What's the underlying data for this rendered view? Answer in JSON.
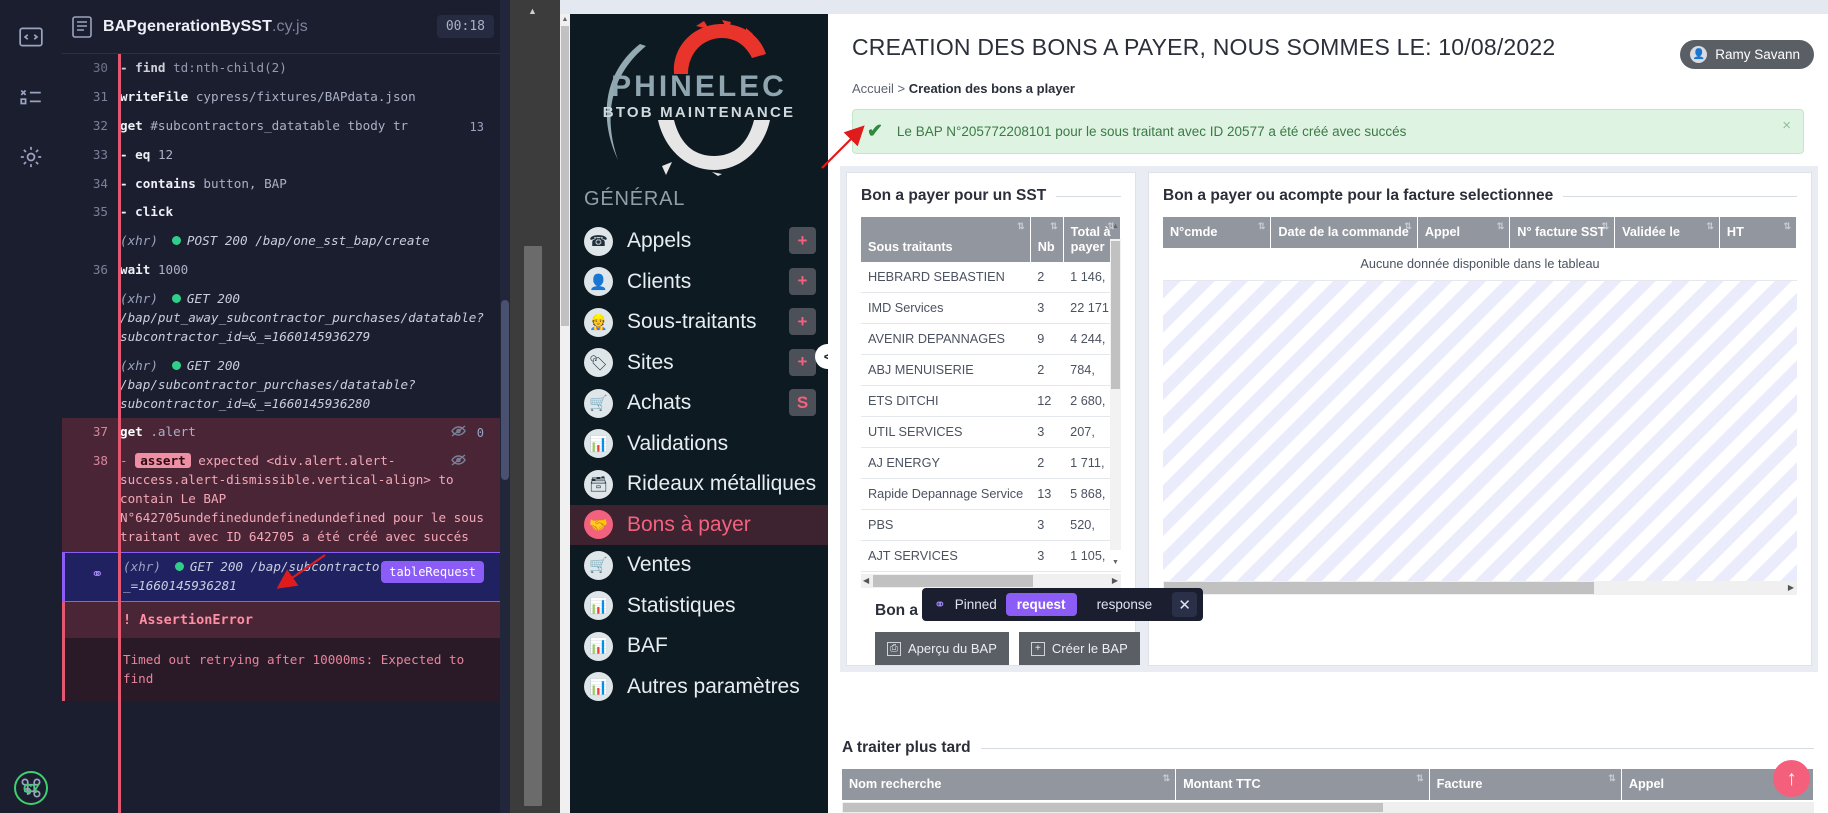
{
  "cypress": {
    "spec_name": "BAPgenerationBySST",
    "spec_ext": ".cy.js",
    "timer": "00:18",
    "iconbar": [
      "code-icon",
      "tests-list-icon",
      "gear-icon"
    ],
    "badge": "CY",
    "rows": [
      {
        "num": "30",
        "cmd": "- find",
        "arg": "td:nth-child(2)",
        "type": "cmd",
        "partial": true
      },
      {
        "num": "31",
        "cmd": "writeFile",
        "arg": "cypress/fixtures/BAPdata.json",
        "type": "cmd"
      },
      {
        "num": "32",
        "cmd": "get",
        "arg": "#subcontractors_datatable tbody tr",
        "type": "cmd",
        "count": "13"
      },
      {
        "num": "33",
        "cmd": "- eq",
        "arg": "12",
        "type": "cmd"
      },
      {
        "num": "34",
        "cmd": "- contains",
        "arg": "button, BAP",
        "type": "cmd"
      },
      {
        "num": "35",
        "cmd": "- click",
        "arg": "",
        "type": "cmd"
      },
      {
        "num": "",
        "type": "xhr",
        "tag": "(xhr)",
        "method": "POST 200",
        "url": "/bap/one_sst_bap/create"
      },
      {
        "num": "36",
        "cmd": "wait",
        "arg": "1000",
        "type": "cmd"
      },
      {
        "num": "",
        "type": "xhr",
        "tag": "(xhr)",
        "method": "GET 200",
        "url": "/bap/put_away_subcontractor_purchases/datatable?subcontractor_id=&_=1660145936279"
      },
      {
        "num": "",
        "type": "xhr",
        "tag": "(xhr)",
        "method": "GET 200",
        "url": "/bap/subcontractor_purchases/datatable?subcontractor_id=&_=1660145936280"
      },
      {
        "num": "37",
        "cmd": "get",
        "arg": ".alert",
        "type": "cmd",
        "failed": true,
        "count": "0"
      },
      {
        "num": "38",
        "type": "assert",
        "failed": true,
        "prefix": "-",
        "badge": "assert",
        "text_a": "expected ",
        "element": "<div.alert.alert-success.alert-dismissible.vertical-align>",
        "text_b": " to ",
        "verb": "contain",
        "expected": " Le BAP N°642705undefinedundefinedundefined pour le sous traitant avec ID 642705 a été créé avec succés"
      },
      {
        "num": "",
        "type": "xhr",
        "pinned": true,
        "tag": "(xhr)",
        "method": "GET 200",
        "url": "/bap/subcontractors/datatable?_=1660145936281",
        "badge": "tableRequest"
      }
    ],
    "error_title": "! AssertionError",
    "error_body": "Timed out retrying after 10000ms: Expected to find"
  },
  "pin_toolbar": {
    "pin_icon": "pin-icon",
    "label": "Pinned",
    "tabs": [
      {
        "label": "request",
        "active": true
      },
      {
        "label": "response",
        "active": false
      }
    ],
    "close": "✕"
  },
  "app": {
    "user": {
      "name": "Ramy Savann",
      "avatar_icon": "user-icon"
    },
    "logo": {
      "line1": "PHINELEC",
      "line2": "BTOB MAINTENANCE"
    },
    "sidebar": {
      "section": "GÉNÉRAL",
      "collapse": "<",
      "items": [
        {
          "label": "Appels",
          "icon": "phone-icon",
          "plus": "+",
          "active": false
        },
        {
          "label": "Clients",
          "icon": "user-badge-icon",
          "plus": "+",
          "active": false
        },
        {
          "label": "Sous-traitants",
          "icon": "worker-icon",
          "plus": "+",
          "active": false
        },
        {
          "label": "Sites",
          "icon": "tag-icon",
          "plus": "+",
          "active": false
        },
        {
          "label": "Achats",
          "icon": "cart-icon",
          "plus": "S",
          "active": false
        },
        {
          "label": "Validations",
          "icon": "chart-icon",
          "plus": "",
          "active": false
        },
        {
          "label": "Rideaux métalliques",
          "icon": "shutter-icon",
          "plus": "",
          "active": false
        },
        {
          "label": "Bons à payer",
          "icon": "handshake-icon",
          "plus": "",
          "active": true
        },
        {
          "label": "Ventes",
          "icon": "cart-icon",
          "plus": "",
          "active": false
        },
        {
          "label": "Statistiques",
          "icon": "chart-icon",
          "plus": "",
          "active": false
        },
        {
          "label": "BAF",
          "icon": "chart-icon",
          "plus": "",
          "active": false
        },
        {
          "label": "Autres paramètres",
          "icon": "chart-icon",
          "plus": "",
          "active": false
        }
      ]
    },
    "page": {
      "title": "CREATION DES BONS A PAYER, NOUS SOMMES LE: 10/08/2022",
      "breadcrumb_home": "Accueil",
      "breadcrumb_sep": ">",
      "breadcrumb_current": "Creation des bons a player",
      "alert": {
        "icon": "check-icon",
        "text": "Le BAP N°205772208101 pour le sous traitant avec ID 20577 a été créé avec succés",
        "close": "×"
      },
      "card_left": {
        "title": "Bon a payer pour un SST",
        "columns": [
          "Sous traitants",
          "Nb",
          "Total à payer"
        ],
        "rows": [
          [
            "HEBRARD SEBASTIEN",
            "2",
            "1 146,"
          ],
          [
            "IMD Services",
            "3",
            "22 171,"
          ],
          [
            "AVENIR DEPANNAGES",
            "9",
            "4 244,"
          ],
          [
            "ABJ MENUISERIE",
            "2",
            "784,"
          ],
          [
            "ETS DITCHI",
            "12",
            "2 680,"
          ],
          [
            "UTIL SERVICES",
            "3",
            "207,"
          ],
          [
            "AJ ENERGY",
            "2",
            "1 711,"
          ],
          [
            "Rapide Depannage Service",
            "13",
            "5 868,"
          ],
          [
            "PBS",
            "3",
            "520,"
          ],
          [
            "AJT SERVICES",
            "3",
            "1 105,"
          ]
        ],
        "global_title": "Bon a Payer global",
        "buttons": [
          {
            "label": "Aperçu du BAP",
            "icon": "printer-icon"
          },
          {
            "label": "Créer le BAP",
            "icon": "plus-box-icon"
          }
        ]
      },
      "card_right": {
        "title": "Bon a payer ou acompte pour la facture selectionnee",
        "columns": [
          "N°cmde",
          "Date de la commande",
          "Appel",
          "N° facture SST",
          "Validée le",
          "HT"
        ],
        "empty": "Aucune donnée disponible dans le tableau"
      },
      "later": {
        "title": "A traiter plus tard",
        "columns": [
          "Nom recherche",
          "Montant TTC",
          "Facture",
          "Appel"
        ]
      },
      "fab": "↑"
    }
  }
}
